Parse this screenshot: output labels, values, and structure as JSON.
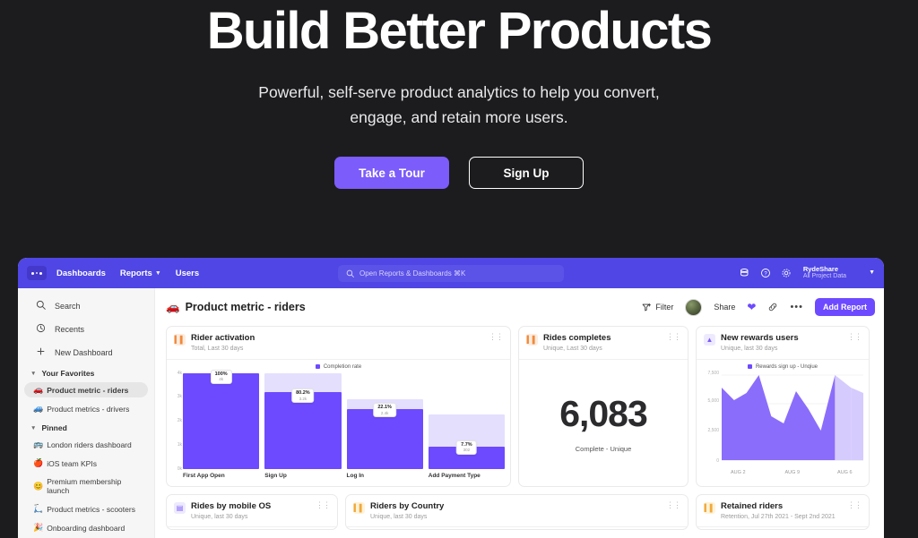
{
  "hero": {
    "title": "Build Better Products",
    "subtitle_line1": "Powerful, self-serve product analytics to help you convert,",
    "subtitle_line2": "engage, and retain more users.",
    "primary_button": "Take a Tour",
    "secondary_button": "Sign Up",
    "background_color": "#1c1c1e",
    "accent_color": "#7c5cfa"
  },
  "app": {
    "navbar": {
      "brand_color": "#4f46e5",
      "logo_name": "app-logo",
      "items": [
        {
          "label": "Dashboards",
          "has_caret": false
        },
        {
          "label": "Reports",
          "has_caret": true
        },
        {
          "label": "Users",
          "has_caret": false
        }
      ],
      "search_placeholder": "Open Reports &  Dashboards ⌘K",
      "icons": [
        "database-icon",
        "help-icon",
        "gear-icon"
      ],
      "account_name": "RydeShare",
      "account_scope": "All Project Data"
    },
    "sidebar": {
      "quick_items": [
        {
          "icon": "search-icon",
          "label": "Search"
        },
        {
          "icon": "clock-icon",
          "label": "Recents"
        },
        {
          "icon": "plus-icon",
          "label": "New Dashboard"
        }
      ],
      "sections": [
        {
          "title": "Your Favorites",
          "items": [
            {
              "emoji": "🚗",
              "label": "Product metric - riders",
              "active": true
            },
            {
              "emoji": "🚙",
              "label": "Product metrics - drivers",
              "active": false
            }
          ]
        },
        {
          "title": "Pinned",
          "items": [
            {
              "emoji": "🚌",
              "label": "London riders dashboard",
              "active": false
            },
            {
              "emoji": "🍎",
              "label": "iOS team KPIs",
              "active": false
            },
            {
              "emoji": "😊",
              "label": "Premium membership launch",
              "active": false
            },
            {
              "emoji": "🛴",
              "label": "Product metrics - scooters",
              "active": false
            },
            {
              "emoji": "🎉",
              "label": "Onboarding dashboard",
              "active": false
            }
          ]
        }
      ]
    },
    "page": {
      "title_emoji": "🚗",
      "title": "Product metric - riders",
      "toolbar": {
        "filter_label": "Filter",
        "share_label": "Share",
        "favorite_icon": "heart-icon",
        "link_icon": "link-icon",
        "more_icon": "more-icon",
        "add_report_label": "Add Report"
      }
    },
    "cards": [
      {
        "icon": "bar-chart-icon",
        "icon_style": "orange",
        "title": "Rider activation",
        "subtitle": "Total, Last 30 days"
      },
      {
        "icon": "bar-chart-icon",
        "icon_style": "orange",
        "title": "Rides completes",
        "subtitle": "Unique, Last 30 days"
      },
      {
        "icon": "area-chart-icon",
        "icon_style": "purple",
        "title": "New rewards users",
        "subtitle": "Unique, last 30 days"
      }
    ],
    "cards_bottom": [
      {
        "icon": "chart-icon",
        "icon_style": "purple",
        "title": "Rides by mobile OS",
        "subtitle": "Unique, last 30 days"
      },
      {
        "icon": "bar-chart-icon",
        "icon_style": "amber",
        "title": "Riders by Country",
        "subtitle": "Unique, last 30 days"
      },
      {
        "icon": "bar-chart-icon",
        "icon_style": "amber",
        "title": "Retained riders",
        "subtitle": "Retention, Jul 27th 2021 - Sept 2nd 2021"
      }
    ],
    "big_metric": {
      "value": "6,083",
      "label": "Complete - Unique"
    }
  },
  "chart_data": [
    {
      "type": "bar",
      "title": "Rider activation",
      "subtitle": "Total, Last 30 days",
      "legend": [
        "Completion rate"
      ],
      "legend_position": "top-center",
      "categories": [
        "First App Open",
        "Sign Up",
        "Log In",
        "Add Payment Type"
      ],
      "values": [
        100,
        80.2,
        22.1,
        7.7
      ],
      "value_labels": [
        "100%",
        "80.2%",
        "22.1%",
        "7.7%"
      ],
      "secondary_labels": [
        "4k",
        "3.2k",
        "2.4k",
        "302"
      ],
      "ylabel": "",
      "xlabel": "",
      "yticks": [
        "4k",
        "3k",
        "2k",
        "1k",
        "0k"
      ],
      "ylim": [
        0,
        100
      ],
      "grid": false,
      "color": "#6d4aff",
      "track_color": "#e4dffd"
    },
    {
      "type": "table",
      "title": "Rides completes",
      "subtitle": "Unique, Last 30 days",
      "value": "6,083",
      "label": "Complete - Unique"
    },
    {
      "type": "area",
      "title": "New rewards users",
      "subtitle": "Unique, last 30 days",
      "legend": [
        "Rewards sign up - Unqiue"
      ],
      "legend_position": "top-center",
      "yticks": [
        "0",
        "2,500",
        "5,000",
        "7,500"
      ],
      "ylim": [
        0,
        7500
      ],
      "xticks": [
        "AUG 2",
        "AUG 9",
        "AUG 6"
      ],
      "x": [
        0,
        1,
        2,
        3,
        4,
        5,
        6,
        7,
        8,
        9,
        10
      ],
      "values": [
        6400,
        5400,
        6000,
        7500,
        4400,
        3800,
        6200,
        4900,
        3100,
        7500,
        6400
      ],
      "grid": true,
      "color": "#8b6dfb",
      "projection_color": "#d6cbfd"
    }
  ]
}
